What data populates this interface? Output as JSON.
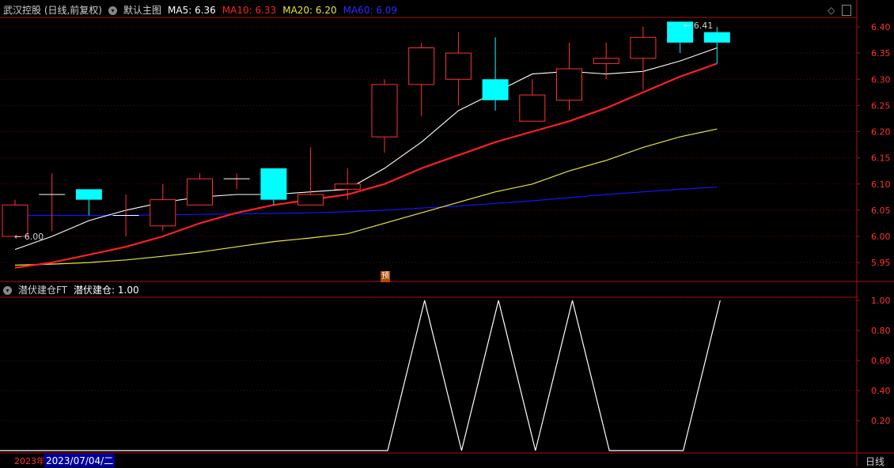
{
  "main_header": {
    "stock": "武汉控股 (日线,前复权)",
    "template": "默认主图",
    "ma5": "MA5: 6.36",
    "ma10": "MA10: 6.33",
    "ma20": "MA20: 6.20",
    "ma60": "MA60: 6.09"
  },
  "sub_header": {
    "name": "潜伏建仓FT",
    "value": "潜伏建仓: 1.00"
  },
  "annotations": {
    "low_marker": "← 6.00",
    "high_marker": "← 6.41",
    "preview_badge": "预"
  },
  "footer": {
    "year_label": "2023年",
    "date_label": "2023/07/04/二",
    "period_button": "日线"
  },
  "colors": {
    "up": "#ff3232",
    "down": "#00ffff",
    "ma5": "#ffffff",
    "ma10": "#ff2020",
    "ma20": "#e6e640",
    "ma60": "#1414ff",
    "axis": "#b01010",
    "indicator": "#ffffff"
  },
  "chart_data": [
    {
      "type": "candlestick",
      "title": "武汉控股 (日线,前复权)",
      "yticks": [
        5.95,
        6.0,
        6.05,
        6.1,
        6.15,
        6.2,
        6.25,
        6.3,
        6.35,
        6.4
      ],
      "ylim": [
        5.92,
        6.42
      ],
      "candles": [
        {
          "o": 6.0,
          "h": 6.07,
          "l": 6.0,
          "c": 6.06
        },
        {
          "o": 6.08,
          "h": 6.12,
          "l": 6.01,
          "c": 6.08
        },
        {
          "o": 6.09,
          "h": 6.09,
          "l": 6.04,
          "c": 6.07
        },
        {
          "o": 6.04,
          "h": 6.08,
          "l": 6.0,
          "c": 6.04
        },
        {
          "o": 6.02,
          "h": 6.1,
          "l": 6.01,
          "c": 6.07
        },
        {
          "o": 6.06,
          "h": 6.12,
          "l": 6.06,
          "c": 6.11
        },
        {
          "o": 6.11,
          "h": 6.12,
          "l": 6.09,
          "c": 6.11
        },
        {
          "o": 6.13,
          "h": 6.13,
          "l": 6.06,
          "c": 6.07
        },
        {
          "o": 6.06,
          "h": 6.17,
          "l": 6.06,
          "c": 6.08
        },
        {
          "o": 6.09,
          "h": 6.13,
          "l": 6.07,
          "c": 6.1
        },
        {
          "o": 6.19,
          "h": 6.3,
          "l": 6.16,
          "c": 6.29
        },
        {
          "o": 6.29,
          "h": 6.37,
          "l": 6.23,
          "c": 6.36
        },
        {
          "o": 6.3,
          "h": 6.39,
          "l": 6.25,
          "c": 6.35
        },
        {
          "o": 6.3,
          "h": 6.38,
          "l": 6.24,
          "c": 6.26
        },
        {
          "o": 6.22,
          "h": 6.3,
          "l": 6.22,
          "c": 6.27
        },
        {
          "o": 6.26,
          "h": 6.37,
          "l": 6.24,
          "c": 6.32
        },
        {
          "o": 6.33,
          "h": 6.37,
          "l": 6.3,
          "c": 6.34
        },
        {
          "o": 6.34,
          "h": 6.4,
          "l": 6.28,
          "c": 6.38
        },
        {
          "o": 6.41,
          "h": 6.41,
          "l": 6.35,
          "c": 6.37
        },
        {
          "o": 6.39,
          "h": 6.4,
          "l": 6.33,
          "c": 6.37
        }
      ],
      "series": [
        {
          "name": "MA5",
          "values": [
            5.975,
            6.0,
            6.03,
            6.05,
            6.065,
            6.075,
            6.08,
            6.08,
            6.085,
            6.09,
            6.13,
            6.18,
            6.24,
            6.275,
            6.31,
            6.315,
            6.31,
            6.315,
            6.335,
            6.36
          ]
        },
        {
          "name": "MA10",
          "values": [
            5.94,
            5.95,
            5.965,
            5.98,
            6.0,
            6.025,
            6.045,
            6.06,
            6.07,
            6.08,
            6.1,
            6.13,
            6.155,
            6.18,
            6.2,
            6.22,
            6.245,
            6.275,
            6.305,
            6.33
          ]
        },
        {
          "name": "MA20",
          "values": [
            5.945,
            5.947,
            5.95,
            5.955,
            5.962,
            5.97,
            5.98,
            5.99,
            5.997,
            6.005,
            6.025,
            6.045,
            6.065,
            6.085,
            6.1,
            6.125,
            6.145,
            6.17,
            6.19,
            6.205
          ]
        },
        {
          "name": "MA60",
          "values": [
            6.04,
            6.04,
            6.04,
            6.04,
            6.041,
            6.042,
            6.043,
            6.044,
            6.045,
            6.047,
            6.05,
            6.054,
            6.058,
            6.063,
            6.068,
            6.074,
            6.08,
            6.085,
            6.09,
            6.094
          ]
        }
      ]
    },
    {
      "type": "line",
      "title": "潜伏建仓FT",
      "yticks": [
        0.2,
        0.4,
        0.6,
        0.8,
        1.0
      ],
      "ylim": [
        0,
        1.05
      ],
      "series": [
        {
          "name": "潜伏建仓",
          "values": [
            0,
            0,
            0,
            0,
            0,
            0,
            0,
            0,
            0,
            0,
            0,
            1,
            0,
            1,
            0,
            1,
            0,
            0,
            0,
            1
          ]
        }
      ]
    }
  ]
}
